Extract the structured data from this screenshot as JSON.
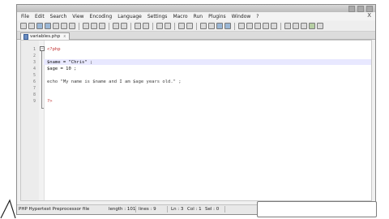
{
  "menu": [
    "File",
    "Edit",
    "Search",
    "View",
    "Encoding",
    "Language",
    "Settings",
    "Macro",
    "Run",
    "Plugins",
    "Window",
    "?"
  ],
  "menu_close": "X",
  "tab": {
    "label": "variables.php",
    "close": "x"
  },
  "editor": {
    "lines": [
      {
        "no": "1",
        "text": "<?php"
      },
      {
        "no": "2",
        "text": ""
      },
      {
        "no": "3",
        "text": "$name = \"Chris\" ;"
      },
      {
        "no": "4",
        "text": "$age = 10 ;"
      },
      {
        "no": "5",
        "text": ""
      },
      {
        "no": "6",
        "text": "echo \"My name is $name and I am $age years old.\" ;"
      },
      {
        "no": "7",
        "text": ""
      },
      {
        "no": "8",
        "text": ""
      },
      {
        "no": "9",
        "text": "?>"
      }
    ]
  },
  "status": {
    "language": "PHP Hypertext Preprocessor file",
    "length": "length : 101",
    "lines": "lines : 9",
    "ln": "Ln : 3",
    "col": "Col : 1",
    "sel": "Sel : 0"
  },
  "colors": {
    "keyword": "#c03030",
    "current_line": "#e8e8ff",
    "gutter": "#ececec"
  }
}
